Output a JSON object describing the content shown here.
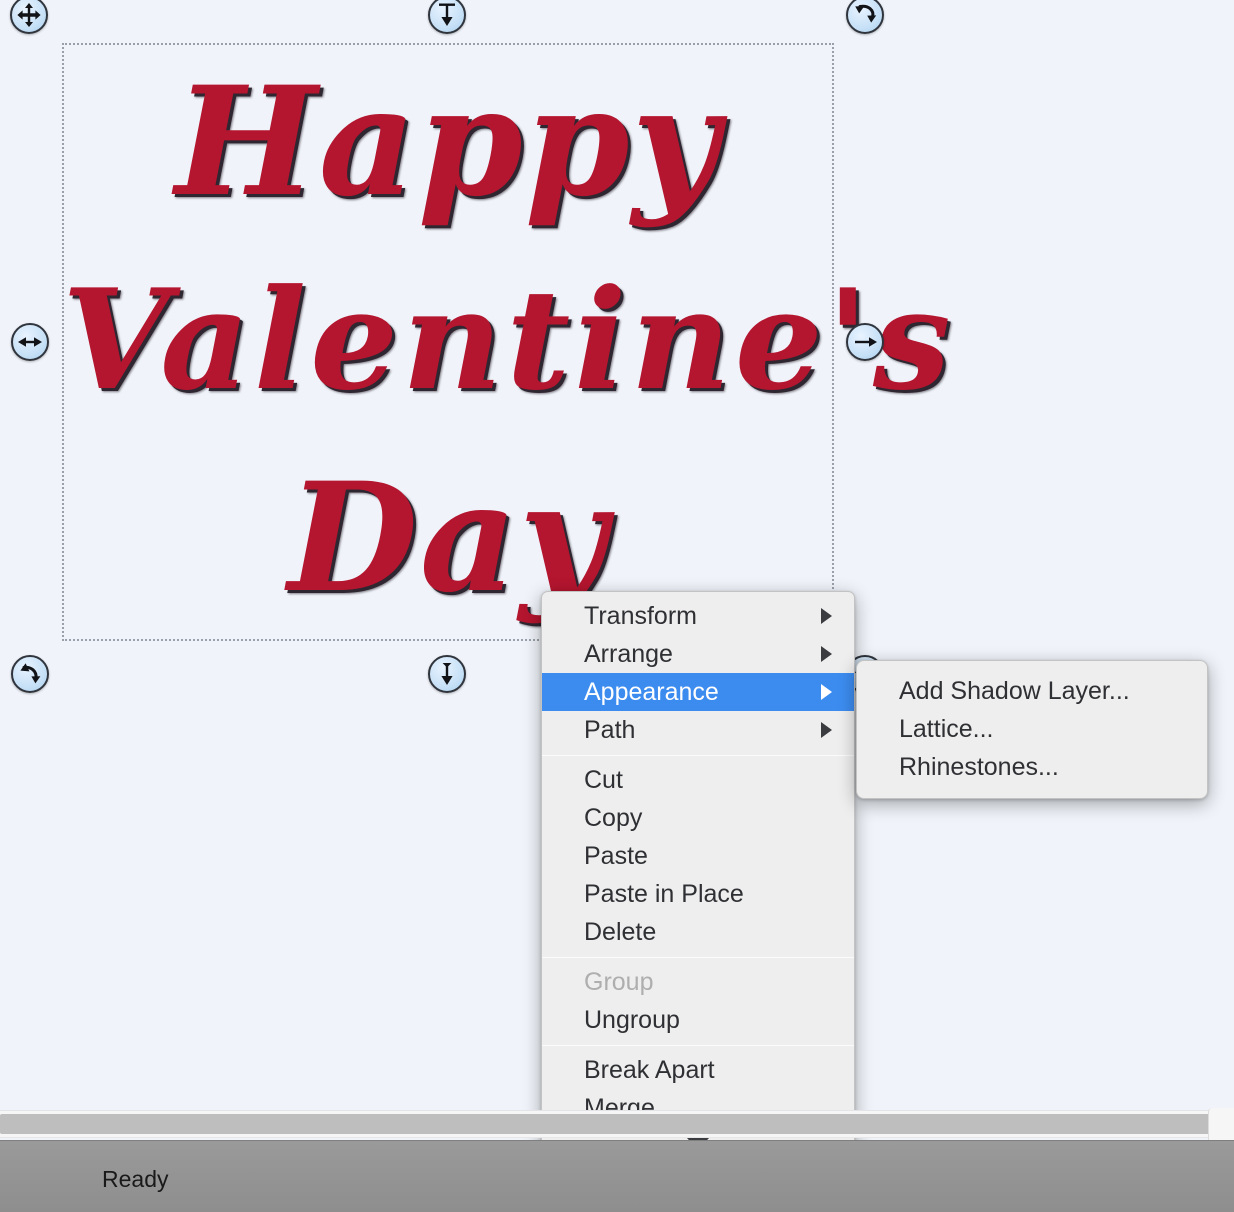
{
  "app": {
    "canvas_background": "#f0f4fa",
    "status_text": "Ready"
  },
  "artwork": {
    "line1": "Happy",
    "line2": "Valentine's",
    "line3": "Day",
    "fill_color": "#b4152f",
    "shadow_color": "#2e2630"
  },
  "selection": {
    "handles": [
      {
        "name": "move-handle",
        "icon": "move-4way-icon",
        "position": "top-left"
      },
      {
        "name": "resize-vertical-handle-top",
        "icon": "resize-vertical-icon",
        "position": "top-center"
      },
      {
        "name": "rotate-handle-top-right",
        "icon": "rotate-icon",
        "position": "top-right"
      },
      {
        "name": "resize-horizontal-handle-left",
        "icon": "resize-horizontal-icon",
        "position": "middle-left"
      },
      {
        "name": "resize-horizontal-handle-right",
        "icon": "resize-horizontal-icon",
        "position": "middle-right"
      },
      {
        "name": "rotate-handle-bottom-left",
        "icon": "rotate-icon",
        "position": "bottom-left"
      },
      {
        "name": "resize-vertical-handle-bottom",
        "icon": "resize-vertical-icon",
        "position": "bottom-center"
      },
      {
        "name": "rotate-handle-bottom-right",
        "icon": "rotate-icon",
        "position": "bottom-right"
      }
    ]
  },
  "context_menu": {
    "highlight_color": "#3c8cf0",
    "groups": [
      {
        "items": [
          {
            "label": "Transform",
            "submenu": true,
            "disabled": false,
            "selected": false
          },
          {
            "label": "Arrange",
            "submenu": true,
            "disabled": false,
            "selected": false
          },
          {
            "label": "Appearance",
            "submenu": true,
            "disabled": false,
            "selected": true
          },
          {
            "label": "Path",
            "submenu": true,
            "disabled": false,
            "selected": false
          }
        ]
      },
      {
        "items": [
          {
            "label": "Cut",
            "submenu": false,
            "disabled": false,
            "selected": false
          },
          {
            "label": "Copy",
            "submenu": false,
            "disabled": false,
            "selected": false
          },
          {
            "label": "Paste",
            "submenu": false,
            "disabled": false,
            "selected": false
          },
          {
            "label": "Paste in Place",
            "submenu": false,
            "disabled": false,
            "selected": false
          },
          {
            "label": "Delete",
            "submenu": false,
            "disabled": false,
            "selected": false
          }
        ]
      },
      {
        "items": [
          {
            "label": "Group",
            "submenu": false,
            "disabled": true,
            "selected": false
          },
          {
            "label": "Ungroup",
            "submenu": false,
            "disabled": false,
            "selected": false
          }
        ]
      },
      {
        "items": [
          {
            "label": "Break Apart",
            "submenu": false,
            "disabled": false,
            "selected": false
          },
          {
            "label": "Merge",
            "submenu": false,
            "disabled": false,
            "selected": false
          }
        ]
      }
    ],
    "scroll_down_indicator": "▼"
  },
  "submenu": {
    "parent": "Appearance",
    "items": [
      {
        "label": "Add Shadow Layer...",
        "disabled": false
      },
      {
        "label": "Lattice...",
        "disabled": false
      },
      {
        "label": "Rhinestones...",
        "disabled": false
      }
    ]
  }
}
